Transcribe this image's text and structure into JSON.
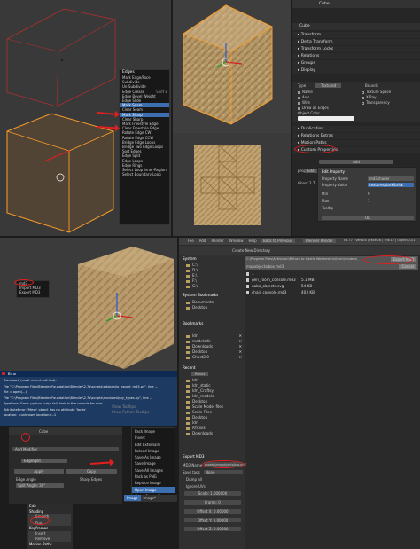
{
  "edges_menu": {
    "title": "Edges",
    "items": [
      "Mark Edge/Face",
      "Subdivide",
      "Un-Subdivide",
      "Edge Crease",
      "Edge Bevel Weight",
      "Edge Slide",
      "Mark Seam",
      "Clear Seam",
      "Mark Sharp",
      "Clear Sharp",
      "Mark Freestyle Edge",
      "Clear Freestyle Edge",
      "Rotate Edge CW",
      "Rotate Edge CCW",
      "Bridge Edge Loops",
      "Bridge Two Edge Loops",
      "Sort Edges",
      "Edge Split",
      "Edge Loops",
      "Edge Rings",
      "Select Loop Inner-Region",
      "Select Boundary Loop"
    ],
    "shortcuts": [
      "",
      "",
      "",
      "Shift E",
      "",
      "",
      "",
      "",
      "",
      "",
      "",
      "",
      "",
      "",
      "",
      "",
      "",
      "",
      "",
      "",
      "",
      ""
    ],
    "highlight_index": 6,
    "highlight_index_2": 8
  },
  "props": {
    "object_name": "Cube",
    "data_name": "Cube",
    "sections": [
      "Transform",
      "Delta Transform",
      "Transform Locks",
      "Relations",
      "Groups",
      "Display"
    ],
    "display": {
      "type_label": "Type",
      "type_value": "Textured",
      "bounds_label": "Bounds",
      "checks_left": [
        "Name",
        "Axis",
        "Wire",
        "Draw all Edges"
      ],
      "checks_right": [
        "Texture Space",
        "X-Ray",
        "Transparency"
      ],
      "object_color_label": "Object Color"
    },
    "sections2": [
      "Duplication",
      "Relations Extras",
      "Motion Paths",
      "Custom Properties"
    ],
    "add_label": "Add",
    "prop_key": "prop",
    "edit_button": "Edit",
    "edit_property_title": "Edit Property",
    "property_name_label": "Property Name",
    "property_name_value": "md3shader",
    "property_value_label": "Property Value",
    "property_value_value": "textures/dark/brick",
    "min_label": "Min",
    "min_value": "0",
    "max_label": "Max",
    "max_value": "1",
    "tooltip_label": "Tooltip",
    "ok_label": "OK",
    "ghost_text": "Ghost 2.7"
  },
  "error_panel": {
    "title": "Error",
    "lines": [
      "Traceback (most recent call last):",
      "  File \"C:\\Program Files\\Blender Foundation\\Blender\\2.7x\\scripts\\addons\\io_export_md3.py\", line ...",
      "    file = open(...)",
      "  File \"C:\\Program Files\\Blender Foundation\\Blender\\2.7x\\scripts\\modules\\bpy_types.py\", line ...",
      "TypeError: Error: python script fail, look in the console for now...",
      "AttributeError: 'Mesh' object has no attribute 'faces'",
      "location: <unknown location>:-1"
    ]
  },
  "small_menu": {
    "items": [
      "md3",
      "Import MD3",
      "Export MD3"
    ]
  },
  "view_menu": {
    "items": [
      "Show Tooltips",
      "Show Python Tooltips"
    ]
  },
  "modifier_panel": {
    "object_name": "Cube",
    "add_modifier": "Add Modifier",
    "edge_split_name": "EdgeSplit",
    "apply_label": "Apply",
    "copy_label": "Copy",
    "edge_angle_label": "Edge Angle",
    "sharp_edges_label": "Sharp Edges",
    "split_angle_label": "Split Angle: 30°"
  },
  "image_menu": {
    "items": [
      "Pack Image",
      "Invert",
      "Edit Externally",
      "Reload Image",
      "Save As Image",
      "Save Image",
      "Save All Images",
      "Pack as PNG",
      "Replace Image",
      "Open Image",
      "Open Cached Image"
    ],
    "highlight_index": 9,
    "bottom_tabs": [
      "Image",
      "Image*"
    ]
  },
  "tools_panel": {
    "items": [
      "Edit",
      "Shading",
      "Smooth",
      "Flat",
      "Keyframes",
      "Insert",
      "Remove",
      "Motion Paths"
    ]
  },
  "file_browser": {
    "menu": [
      "File",
      "Add",
      "Render",
      "Window",
      "Help"
    ],
    "back_label": "Back to Previous",
    "engine": "Blender Render",
    "version": "v2.77 | Verts:8 | Faces:6 | Tris:12 | Objects:1/1",
    "create_dir": "Create New Directory",
    "path": "C:\\Program Files\\Activision\\Return to Castle Wolfenstein\\Main\\models\\",
    "filename": "mapobjects/box.md3",
    "export_button": "Export MD3",
    "cancel_button": "Cancel",
    "system_title": "System",
    "drives": [
      "C:\\",
      "D:\\",
      "E:\\",
      "F:\\",
      "G:\\"
    ],
    "bookmarks_title": "System Bookmarks",
    "sys_bookmarks": [
      "Documents",
      "Desktop"
    ],
    "user_bookmarks_title": "Bookmarks",
    "user_bookmarks": [
      "ldrf",
      "modelsdir",
      "Downloads",
      "Desktop",
      "Ghost2.0"
    ],
    "recent_title": "Recent",
    "recent_reset": "Reset",
    "recent": [
      "ldrf",
      "ldrf_static",
      "ldrf_Craftsy",
      "ldrf_models",
      "Desktop",
      "Scale Model files",
      "Scale Files",
      "Desktop",
      "ldrf",
      "RTCW3",
      "Downloads"
    ],
    "files": [
      {
        "name": "..",
        "size": ""
      },
      {
        "name": "gen_room_console.md3",
        "size": "5.1 MB"
      },
      {
        "name": "nabo_objects.svg",
        "size": "54 KB"
      },
      {
        "name": "chair_console.md3",
        "size": "403 KB"
      }
    ],
    "export_title": "Export MD3",
    "md3_name_label": "MD3 Name",
    "md3_name_value": "models/mapobjects/box.md3",
    "save_tags_label": "Save tags",
    "tag_none": "None",
    "dump_all_label": "Dump all",
    "ignore_uvs_label": "Ignore UVs",
    "scale_label": "Scale: 1.000000",
    "frame_label": "Frame: 0",
    "offset_x_label": "Offset X: 0.00000",
    "offset_y_label": "Offset Y: 0.00000",
    "offset_z_label": "Offset Z: 0.00000"
  },
  "colors": {
    "accent_blue": "#3d6fb0",
    "annotation_red": "#e02020",
    "selection_orange": "#f59a2b"
  }
}
